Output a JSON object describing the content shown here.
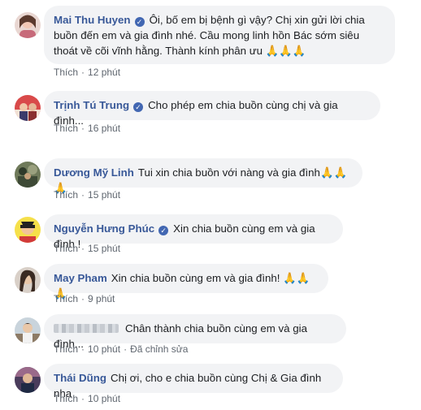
{
  "comments": [
    {
      "name": "Mai Thu Huyen",
      "verified": true,
      "text": "Ôi, bố em bị bệnh gì vậy? Chị xin gửi lời chia buồn đến em và gia đình nhé. Cầu mong linh hồn Bác sớm siêu thoát về cõi vĩnh hằng. Thành kính phân ưu",
      "emoji": "🙏🙏🙏",
      "like": "Thích",
      "time": "12 phút"
    },
    {
      "name": "Trịnh Tú Trung",
      "verified": true,
      "text": "Cho phép em chia buồn cùng chị và gia đình...",
      "emoji": "",
      "like": "Thích",
      "time": "16 phút"
    },
    {
      "name": "Dương Mỹ Linh",
      "verified": false,
      "text": "Tui xin chia buồn với nàng và gia đình",
      "emoji": "🙏🙏🙏",
      "like": "Thích",
      "time": "15 phút"
    },
    {
      "name": "Nguyễn Hưng Phúc",
      "verified": true,
      "text": "Xin chia buồn cùng em và gia đình !",
      "emoji": "",
      "like": "Thích",
      "time": "15 phút"
    },
    {
      "name": "May Pham",
      "verified": false,
      "text": "Xin chia buồn cùng em và gia đình!",
      "emoji": "🙏🙏🙏",
      "like": "Thích",
      "time": "9 phút"
    },
    {
      "name": "",
      "verified": false,
      "text": "Chân thành chia buồn cùng em và gia đình...",
      "emoji": "",
      "like": "Thích",
      "time": "10 phút",
      "edited": "Đã chỉnh sửa"
    },
    {
      "name": "Thái Dũng",
      "verified": false,
      "text": "Chị ơi, cho e chia buồn cùng Chị & Gia đình nha",
      "emoji": "",
      "like": "Thích",
      "time": "10 phút"
    }
  ],
  "colors": {
    "name": "#385898",
    "bubble": "#f2f3f5",
    "meta": "#606770",
    "verified": "#4267b2"
  },
  "icons": {
    "verified": "check-badge-icon",
    "emoji": "folded-hands-emoji"
  }
}
